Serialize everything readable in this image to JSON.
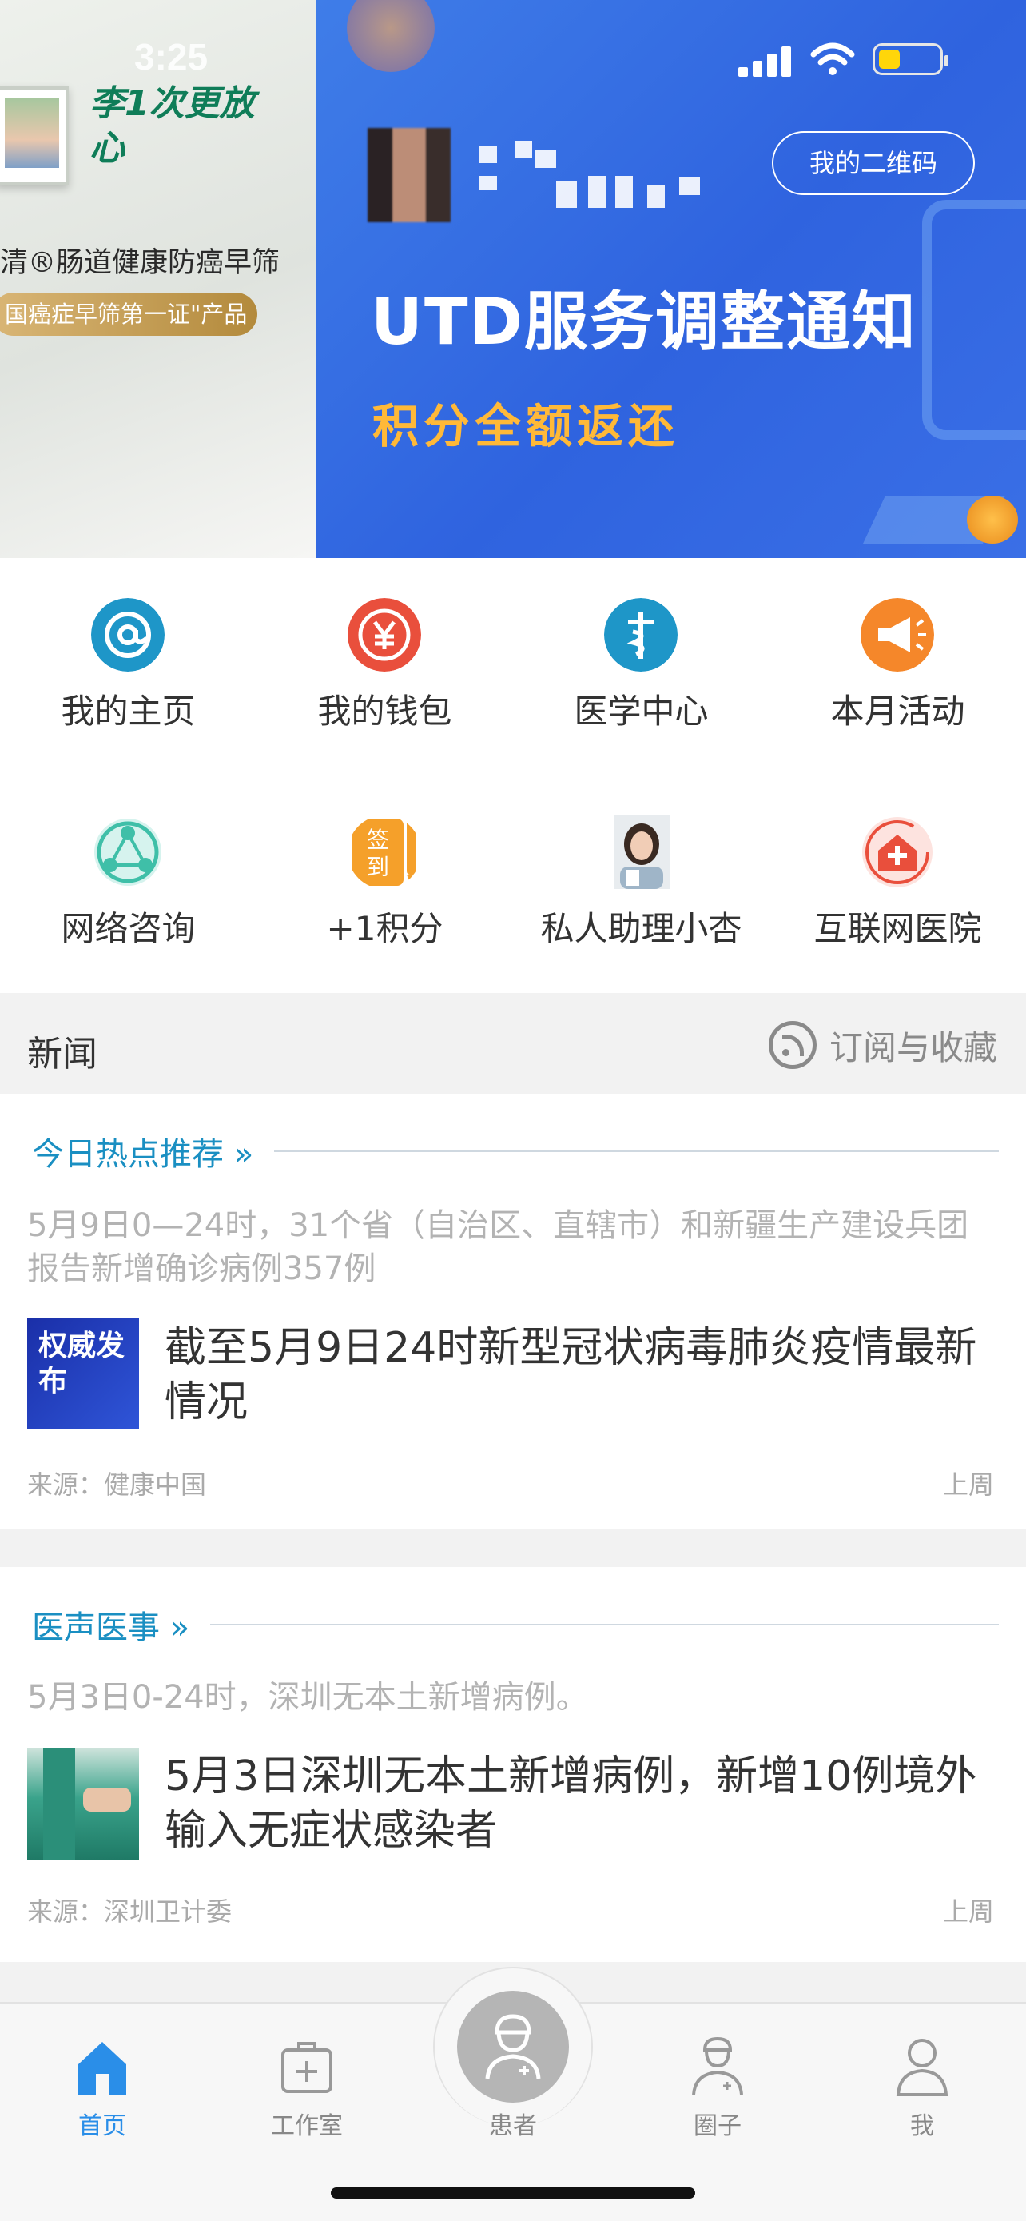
{
  "status_bar": {
    "time": "3:25"
  },
  "banner": {
    "ad_title": "李1次更放心",
    "ad_subtitle": "清®肠道健康防癌早筛",
    "ad_pill": "国癌症早筛第一证\"产品",
    "headline": "UTD服务调整通知",
    "subline": "积分全额返还",
    "qr_button": "我的二维码"
  },
  "menu": [
    {
      "label": "我的主页",
      "icon": "at-icon",
      "color": "#1e96c8"
    },
    {
      "label": "我的钱包",
      "icon": "yen-icon",
      "color": "#e94f3c"
    },
    {
      "label": "医学中心",
      "icon": "caduceus-icon",
      "color": "#1e96c8"
    },
    {
      "label": "本月活动",
      "icon": "megaphone-icon",
      "color": "#f5872a"
    },
    {
      "label": "网络咨询",
      "icon": "network-icon",
      "color": "#3fbfa8"
    },
    {
      "label": "+1积分",
      "icon": "checkin-icon",
      "color": "#f5a02a"
    },
    {
      "label": "私人助理小杏",
      "icon": "assistant-avatar",
      "color": "#9ab"
    },
    {
      "label": "互联网医院",
      "icon": "hospital-icon",
      "color": "#e94f3c"
    }
  ],
  "news": {
    "title": "新闻",
    "subscribe_label": "订阅与收藏",
    "cards": [
      {
        "category": "今日热点推荐 »",
        "summary": "5月9日0—24时，31个省（自治区、直辖市）和新疆生产建设兵团报告新增确诊病例357例",
        "thumb_text": "权威发布",
        "headline": "截至5月9日24时新型冠状病毒肺炎疫情最新情况",
        "source": "来源：健康中国",
        "time": "上周"
      },
      {
        "category": "医声医事 »",
        "summary": "5月3日0-24时，深圳无本土新增病例。",
        "thumb_text": "",
        "headline": "5月3日深圳无本土新增病例，新增10例境外输入无症状感染者",
        "source": "来源：深圳卫计委",
        "time": "上周"
      }
    ]
  },
  "tabbar": [
    {
      "label": "首页",
      "icon": "home-icon",
      "active": true
    },
    {
      "label": "工作室",
      "icon": "medkit-icon",
      "active": false
    },
    {
      "label": "患者",
      "icon": "doctor-icon",
      "active": false
    },
    {
      "label": "圈子",
      "icon": "nurse-icon",
      "active": false
    },
    {
      "label": "我",
      "icon": "user-icon",
      "active": false
    }
  ],
  "colors": {
    "accent": "#1a8fc2",
    "tab_active": "#2a8ee8",
    "banner_blue": "#3a6fe6",
    "banner_gold": "#ffb938"
  }
}
